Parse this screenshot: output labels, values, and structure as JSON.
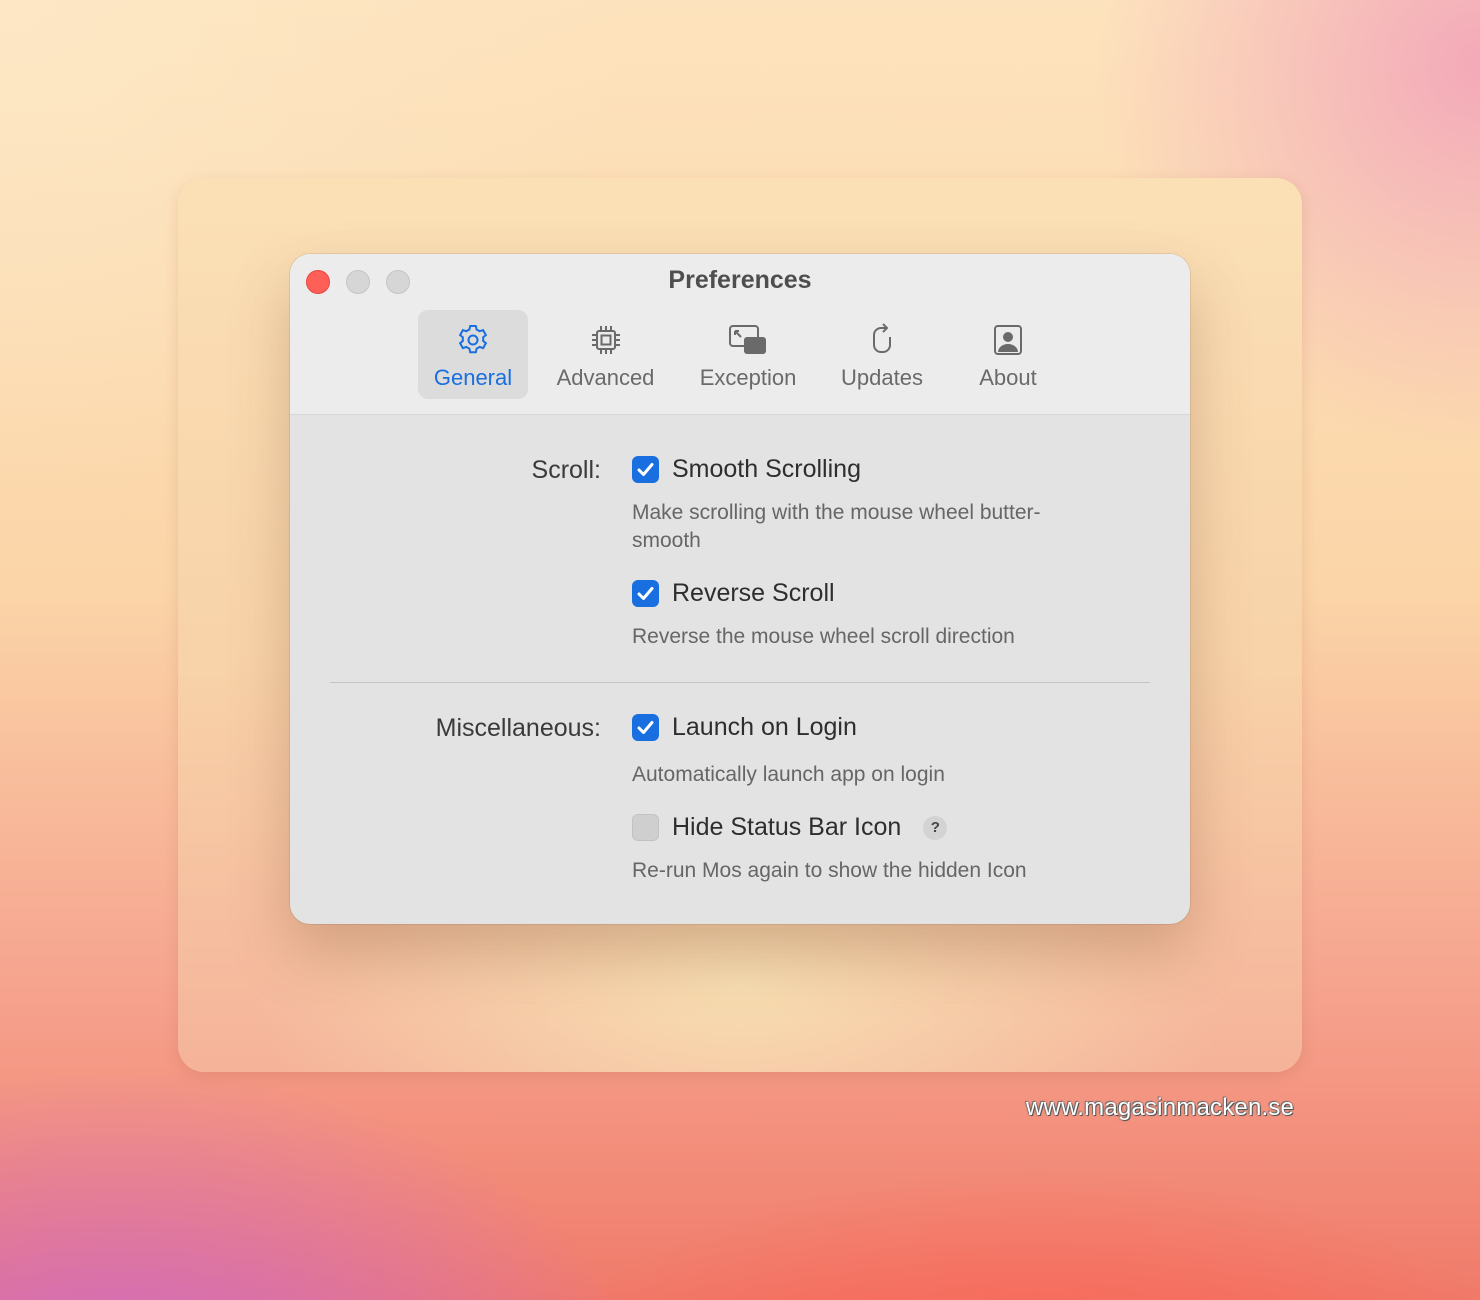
{
  "window": {
    "title": "Preferences"
  },
  "tabs": [
    {
      "label": "General",
      "icon": "gear-icon",
      "active": true
    },
    {
      "label": "Advanced",
      "icon": "chip-icon",
      "active": false
    },
    {
      "label": "Exception",
      "icon": "window-exception-icon",
      "active": false
    },
    {
      "label": "Updates",
      "icon": "refresh-mouse-icon",
      "active": false
    },
    {
      "label": "About",
      "icon": "person-icon",
      "active": false
    }
  ],
  "scroll": {
    "label": "Scroll:",
    "smooth": {
      "label": "Smooth Scrolling",
      "checked": true,
      "desc": "Make scrolling with the mouse wheel butter-smooth"
    },
    "reverse": {
      "label": "Reverse Scroll",
      "checked": true,
      "desc": "Reverse the mouse wheel scroll direction"
    }
  },
  "misc": {
    "label": "Miscellaneous:",
    "launch": {
      "label": "Launch on Login",
      "checked": true,
      "desc": "Automatically launch app on login"
    },
    "hide": {
      "label": "Hide Status Bar Icon",
      "checked": false,
      "help": "?",
      "desc": "Re-run Mos again to show the hidden Icon"
    }
  },
  "watermark": "www.magasinmacken.se",
  "colors": {
    "accent": "#1a6fe0",
    "close": "#fe5f57"
  }
}
